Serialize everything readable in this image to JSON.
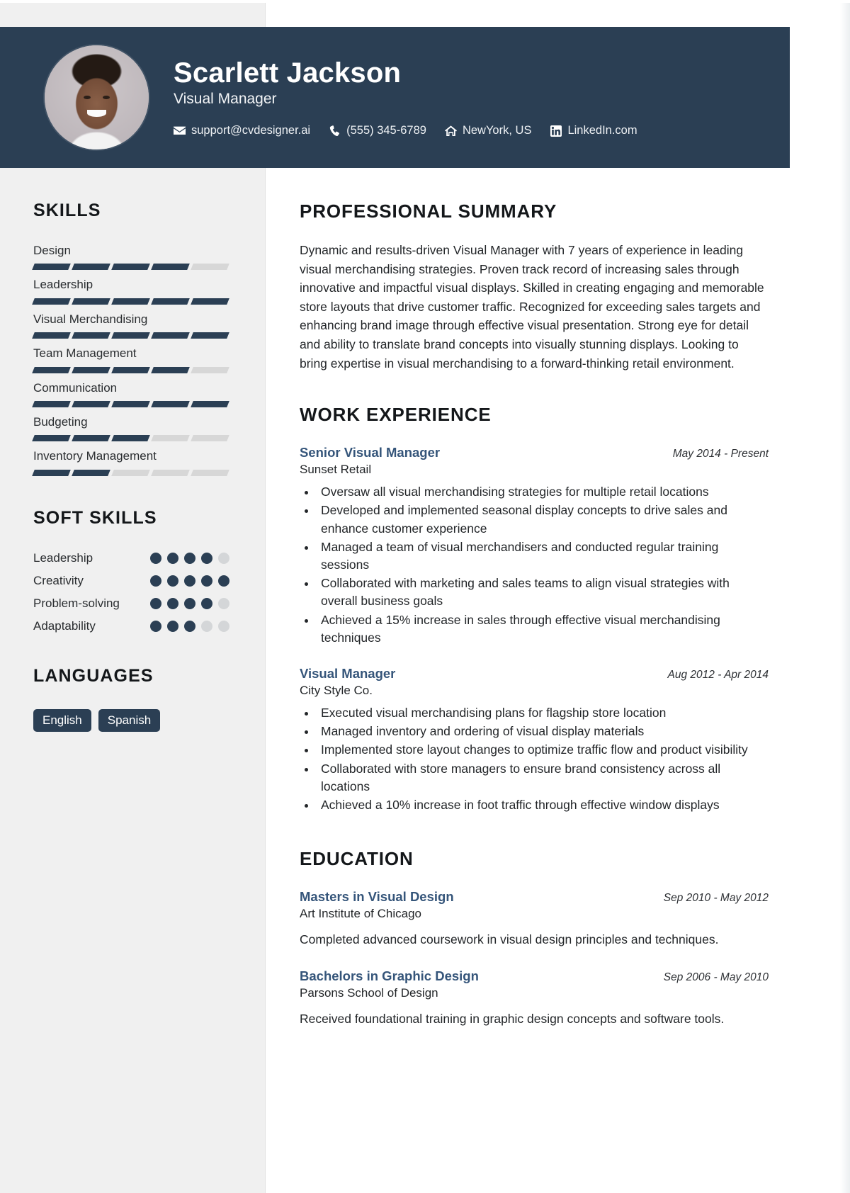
{
  "header": {
    "name": "Scarlett Jackson",
    "job_title": "Visual Manager",
    "avatar_alt": "profile-photo",
    "contacts": [
      {
        "icon": "email-icon",
        "value": "support@cvdesigner.ai"
      },
      {
        "icon": "phone-icon",
        "value": "(555) 345-6789"
      },
      {
        "icon": "home-icon",
        "value": "NewYork, US"
      },
      {
        "icon": "linkedin-icon",
        "value": "LinkedIn.com"
      }
    ]
  },
  "sidebar": {
    "skills_heading": "SKILLS",
    "skills": [
      {
        "label": "Design",
        "level": 4,
        "max": 5
      },
      {
        "label": "Leadership",
        "level": 5,
        "max": 5
      },
      {
        "label": "Visual Merchandising",
        "level": 5,
        "max": 5
      },
      {
        "label": "Team Management",
        "level": 4,
        "max": 5
      },
      {
        "label": "Communication",
        "level": 5,
        "max": 5
      },
      {
        "label": "Budgeting",
        "level": 3,
        "max": 5
      },
      {
        "label": "Inventory Management",
        "level": 2,
        "max": 5
      }
    ],
    "soft_skills_heading": "SOFT SKILLS",
    "soft_skills": [
      {
        "label": "Leadership",
        "level": 4,
        "max": 5
      },
      {
        "label": "Creativity",
        "level": 5,
        "max": 5
      },
      {
        "label": "Problem-solving",
        "level": 4,
        "max": 5
      },
      {
        "label": "Adaptability",
        "level": 3,
        "max": 5
      }
    ],
    "languages_heading": "LANGUAGES",
    "languages": [
      "English",
      "Spanish"
    ]
  },
  "main": {
    "summary_heading": "PROFESSIONAL SUMMARY",
    "summary_text": "Dynamic and results-driven Visual Manager with 7 years of experience in leading visual merchandising strategies. Proven track record of increasing sales through innovative and impactful visual displays. Skilled in creating engaging and memorable store layouts that drive customer traffic. Recognized for exceeding sales targets and enhancing brand image through effective visual presentation. Strong eye for detail and ability to translate brand concepts into visually stunning displays. Looking to bring expertise in visual merchandising to a forward-thinking retail environment.",
    "work_heading": "WORK EXPERIENCE",
    "work": [
      {
        "title": "Senior Visual Manager",
        "date": "May 2014 - Present",
        "org": "Sunset Retail",
        "bullets": [
          "Oversaw all visual merchandising strategies for multiple retail locations",
          "Developed and implemented seasonal display concepts to drive sales and enhance customer experience",
          "Managed a team of visual merchandisers and conducted regular training sessions",
          "Collaborated with marketing and sales teams to align visual strategies with overall business goals",
          "Achieved a 15% increase in sales through effective visual merchandising techniques"
        ]
      },
      {
        "title": "Visual Manager",
        "date": "Aug 2012 - Apr 2014",
        "org": "City Style Co.",
        "bullets": [
          "Executed visual merchandising plans for flagship store location",
          "Managed inventory and ordering of visual display materials",
          "Implemented store layout changes to optimize traffic flow and product visibility",
          "Collaborated with store managers to ensure brand consistency across all locations",
          "Achieved a 10% increase in foot traffic through effective window displays"
        ]
      }
    ],
    "education_heading": "EDUCATION",
    "education": [
      {
        "degree": "Masters in Visual Design",
        "date": "Sep 2010 - May 2012",
        "school": "Art Institute of Chicago",
        "description": "Completed advanced coursework in visual design principles and techniques."
      },
      {
        "degree": "Bachelors in Graphic Design",
        "date": "Sep 2006 - May 2010",
        "school": "Parsons School of Design",
        "description": "Received foundational training in graphic design concepts and software tools."
      }
    ]
  },
  "theme": {
    "navy": "#2b3f54",
    "accent_title": "#35557a",
    "sidebar_bg": "#f0f0f0",
    "bar_empty": "#d7d7d7"
  }
}
